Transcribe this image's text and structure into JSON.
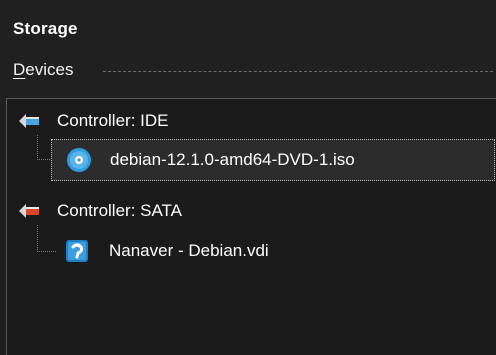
{
  "section": {
    "title": "Storage"
  },
  "devices": {
    "label_accel": "D",
    "label_rest": "evices"
  },
  "tree": {
    "controllers": [
      {
        "label": "Controller: IDE",
        "icon": "ide-controller-icon",
        "attachments": [
          {
            "label": "debian-12.1.0-amd64-DVD-1.iso",
            "icon": "optical-disc-icon",
            "selected": true
          }
        ]
      },
      {
        "label": "Controller: SATA",
        "icon": "sata-controller-icon",
        "attachments": [
          {
            "label": "Nanaver - Debian.vdi",
            "icon": "hard-disk-icon",
            "selected": false
          }
        ]
      }
    ]
  },
  "colors": {
    "background": "#202020",
    "panel": "#1b1b1b",
    "selection": "#2c2c2c",
    "ide_accent": "#4aa3df",
    "sata_accent": "#d9472b",
    "disc_blue": "#2f9be0"
  }
}
